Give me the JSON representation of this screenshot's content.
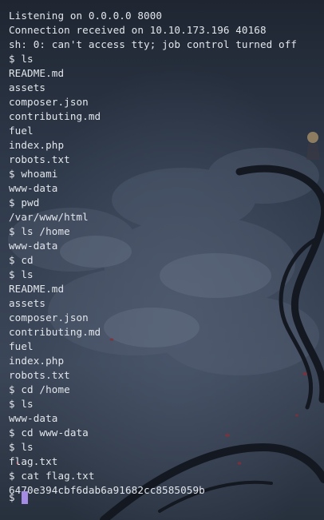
{
  "terminal": {
    "lines": [
      "",
      "Listening on 0.0.0.0 8000",
      "Connection received on 10.10.173.196 40168",
      "sh: 0: can't access tty; job control turned off",
      "$ ls",
      "README.md",
      "assets",
      "composer.json",
      "contributing.md",
      "fuel",
      "index.php",
      "robots.txt",
      "$ whoami",
      "www-data",
      "$ pwd",
      "/var/www/html",
      "$ ls /home",
      "www-data",
      "$ cd",
      "$ ls",
      "README.md",
      "assets",
      "composer.json",
      "contributing.md",
      "fuel",
      "index.php",
      "robots.txt",
      "$ cd /home",
      "$ ls",
      "www-data",
      "$ cd www-data",
      "$ ls",
      "flag.txt",
      "$ cat flag.txt",
      "6470e394cbf6dab6a91682cc8585059b"
    ],
    "prompt": "$",
    "colors": {
      "text": "#e3e7ec",
      "cursor": "#a58be3",
      "background": "#2b3341"
    }
  }
}
